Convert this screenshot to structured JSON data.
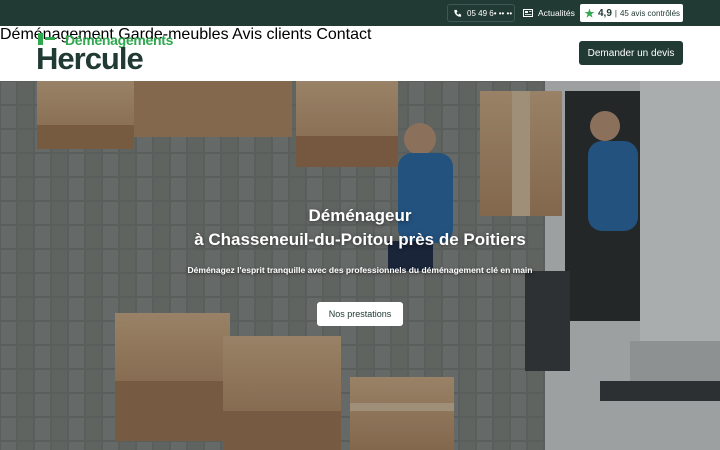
{
  "topbar": {
    "phone": "05 49 6• •• ••",
    "phone_icon": "phone-icon",
    "news": "Actualités",
    "news_icon": "newspaper-icon",
    "rating_score": "4,9",
    "rating_separator": "|",
    "rating_count": "45 avis contrôlés",
    "rating_icon": "star-badge-icon"
  },
  "logo": {
    "top": "Déménagements",
    "main": "Hercule"
  },
  "nav": {
    "items": [
      {
        "label": "Déménagement"
      },
      {
        "label": "Garde-meubles"
      },
      {
        "label": "Avis clients"
      },
      {
        "label": "Contact"
      }
    ],
    "cta": "Demander un devis"
  },
  "hero": {
    "title_line1": "Déménageur",
    "title_line2": "à Chasseneuil-du-Poitou près de Poitiers",
    "subtitle": "Déménagez l'esprit tranquille avec des professionnels du déménagement clé en main",
    "button": "Nos prestations"
  },
  "colors": {
    "brand_dark": "#213a34",
    "brand_green": "#2fa84f"
  }
}
